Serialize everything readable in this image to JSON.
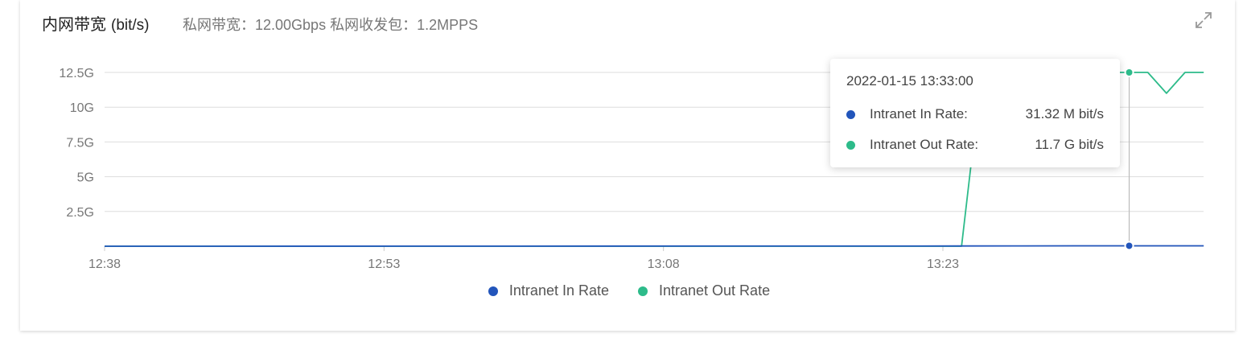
{
  "header": {
    "title": "内网带宽",
    "unit": "(bit/s)",
    "subtitle": "私网带宽：12.00Gbps 私网收发包：1.2MPPS",
    "expand_icon": "expand-icon"
  },
  "colors": {
    "in_rate": "#2255bb",
    "out_rate": "#2dbb8a",
    "grid": "#dddddd",
    "axis_text": "#777777"
  },
  "tooltip": {
    "time": "2022-01-15 13:33:00",
    "rows": [
      {
        "label": "Intranet In Rate:",
        "value": "31.32 M bit/s"
      },
      {
        "label": "Intranet Out Rate:",
        "value": "11.7 G bit/s"
      }
    ]
  },
  "chart_data": {
    "type": "line",
    "title": "内网带宽",
    "ylabel": "",
    "xlabel": "",
    "x_ticks": [
      "12:38",
      "12:53",
      "13:08",
      "13:23"
    ],
    "y_ticks": [
      "2.5G",
      "5G",
      "7.5G",
      "10G",
      "12.5G"
    ],
    "y_tick_values": [
      2.5,
      5,
      7.5,
      10,
      12.5
    ],
    "ylim": [
      0,
      12.5
    ],
    "y_unit": "Gbit/s",
    "xlim": [
      "12:38",
      "13:37"
    ],
    "grid": true,
    "legend_position": "bottom-center",
    "highlight_x": "13:33",
    "series": [
      {
        "name": "Intranet In Rate",
        "x": [
          "12:38",
          "13:24",
          "13:27",
          "13:30",
          "13:33",
          "13:35",
          "13:37"
        ],
        "values": [
          0,
          0.02,
          0.025,
          0.028,
          0.031,
          0.03,
          0.03
        ]
      },
      {
        "name": "Intranet Out Rate",
        "x": [
          "12:38",
          "13:24",
          "13:25",
          "13:26",
          "13:27",
          "13:28",
          "13:29",
          "13:30",
          "13:31",
          "13:32",
          "13:33",
          "13:34",
          "13:35",
          "13:36",
          "13:37"
        ],
        "values": [
          0,
          0,
          11.5,
          11.5,
          11.5,
          11.5,
          11.5,
          11.5,
          12.5,
          12.5,
          12.5,
          12.5,
          11.0,
          12.5,
          12.5
        ]
      }
    ]
  },
  "legend": {
    "items": [
      {
        "label": "Intranet In Rate"
      },
      {
        "label": "Intranet Out Rate"
      }
    ]
  }
}
